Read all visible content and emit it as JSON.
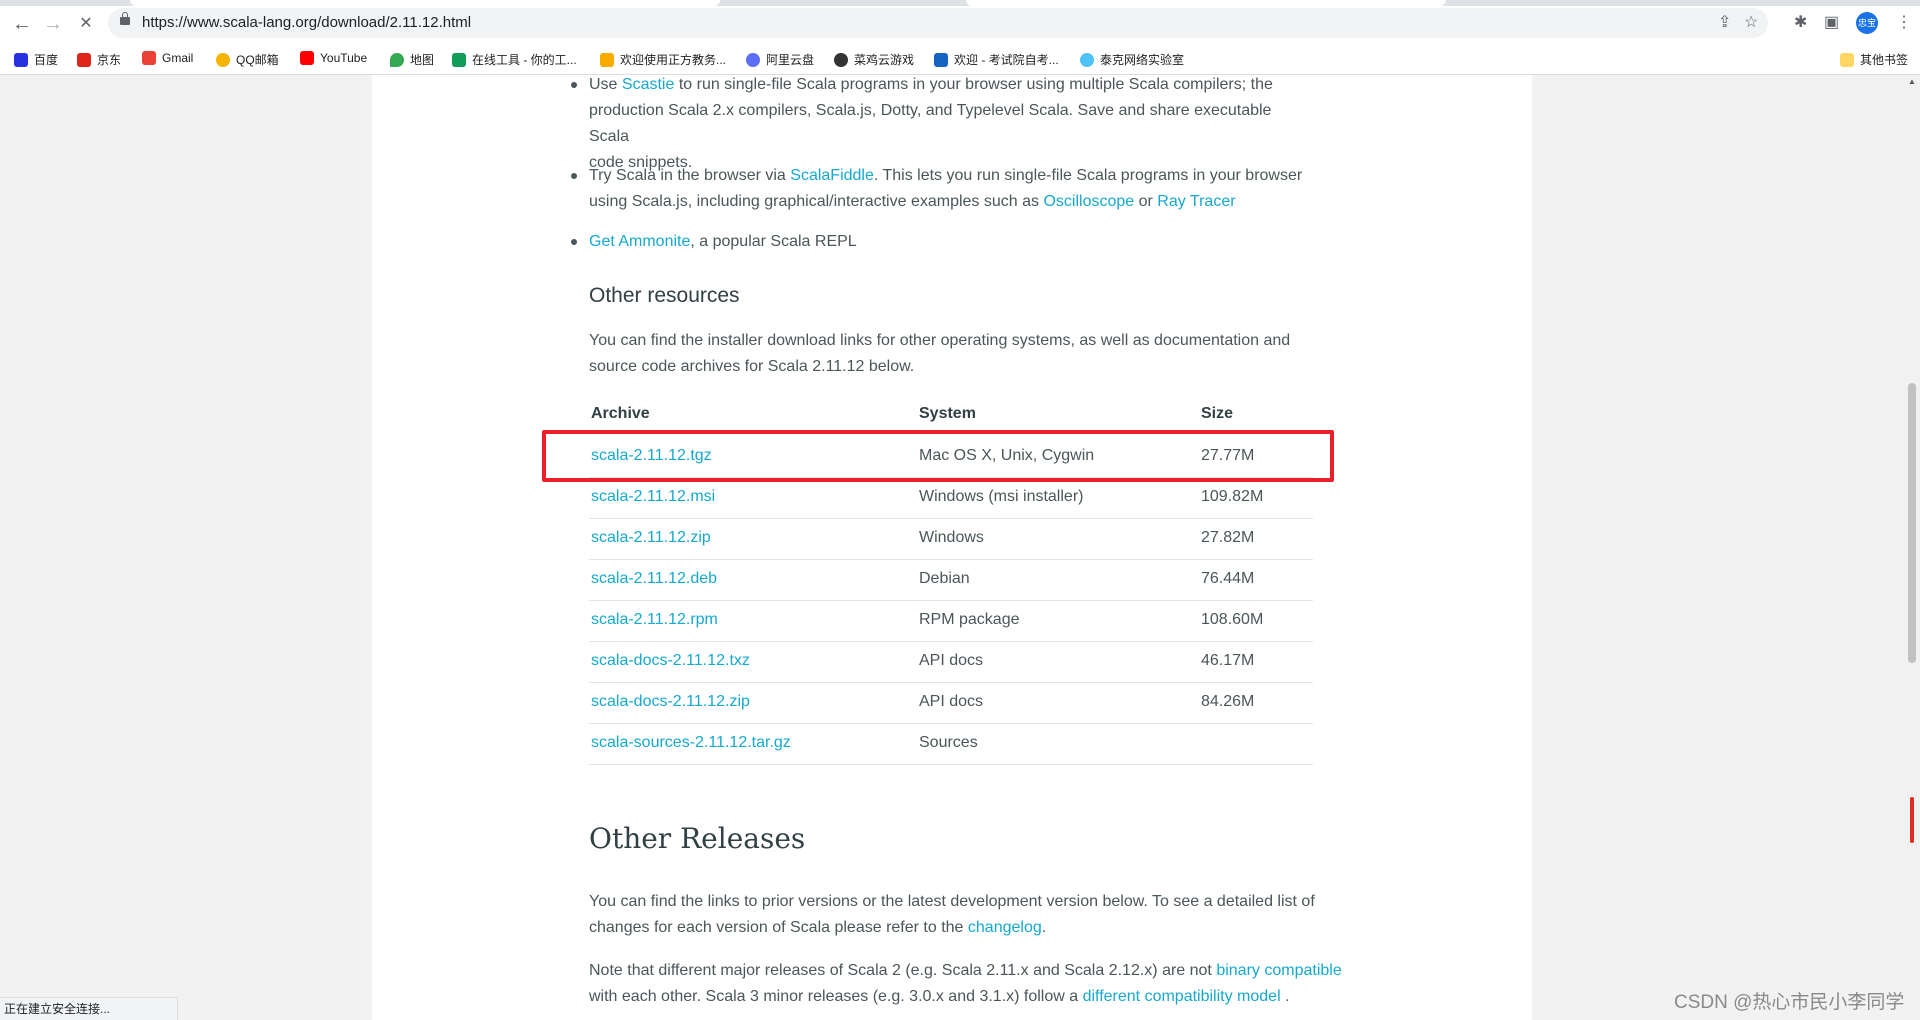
{
  "browser": {
    "url": "https://www.scala-lang.org/download/2.11.12.html",
    "back_label": "←",
    "forward_label": "→",
    "stop_label": "✕",
    "share_icon": "⇪",
    "star_icon": "☆",
    "extensions_icon": "✱",
    "sidepanel_icon": "▣",
    "menu_icon": "⋮",
    "avatar_text": "忠宝",
    "status_text": "正在建立安全连接..."
  },
  "bookmarks": [
    {
      "label": "百度",
      "color": "#2932e1"
    },
    {
      "label": "京东",
      "color": "#e1251b"
    },
    {
      "label": "Gmail",
      "color": "#ea4335"
    },
    {
      "label": "QQ邮箱",
      "color": "#f4b400"
    },
    {
      "label": "YouTube",
      "color": "#ff0000"
    },
    {
      "label": "地图",
      "color": "#34a853"
    },
    {
      "label": "在线工具 - 你的工...",
      "color": "#0f9d58"
    },
    {
      "label": "欢迎使用正方教务...",
      "color": "#f9ab00"
    },
    {
      "label": "阿里云盘",
      "color": "#5b6ef5"
    },
    {
      "label": "菜鸡云游戏",
      "color": "#333333"
    },
    {
      "label": "欢迎 - 考试院自考...",
      "color": "#1565c0"
    },
    {
      "label": "泰克网络实验室",
      "color": "#4fc3f7"
    }
  ],
  "other_bookmarks": "其他书签",
  "intro": {
    "b1_pre": "Use ",
    "b1_link": "Scastie",
    "b1_line1_post": " to run single-file Scala programs in your browser using multiple Scala compilers; the",
    "b1_line2": "production Scala 2.x compilers, Scala.js, Dotty, and Typelevel Scala. Save and share executable Scala",
    "b1_line3": "code snippets.",
    "b2_pre": "Try Scala in the browser via ",
    "b2_link": "ScalaFiddle",
    "b2_line1_post": ". This lets you run single-file Scala programs in your browser",
    "b2_line2_pre": "using Scala.js, including graphical/interactive examples such as ",
    "b2_link2": "Oscilloscope",
    "b2_or": " or ",
    "b2_link3": "Ray Tracer",
    "b3_link": "Get Ammonite",
    "b3_post": ", a popular Scala REPL"
  },
  "other_resources": {
    "heading": "Other resources",
    "line1": "You can find the installer download links for other operating systems, as well as documentation and",
    "line2": "source code archives for Scala 2.11.12 below."
  },
  "table": {
    "headers": {
      "archive": "Archive",
      "system": "System",
      "size": "Size"
    },
    "rows": [
      {
        "archive": "scala-2.11.12.tgz",
        "system": "Mac OS X, Unix, Cygwin",
        "size": "27.77M"
      },
      {
        "archive": "scala-2.11.12.msi",
        "system": "Windows (msi installer)",
        "size": "109.82M"
      },
      {
        "archive": "scala-2.11.12.zip",
        "system": "Windows",
        "size": "27.82M"
      },
      {
        "archive": "scala-2.11.12.deb",
        "system": "Debian",
        "size": "76.44M"
      },
      {
        "archive": "scala-2.11.12.rpm",
        "system": "RPM package",
        "size": "108.60M"
      },
      {
        "archive": "scala-docs-2.11.12.txz",
        "system": "API docs",
        "size": "46.17M"
      },
      {
        "archive": "scala-docs-2.11.12.zip",
        "system": "API docs",
        "size": "84.26M"
      },
      {
        "archive": "scala-sources-2.11.12.tar.gz",
        "system": "Sources",
        "size": ""
      }
    ]
  },
  "other_releases": {
    "heading": "Other Releases",
    "p1_line1": "You can find the links to prior versions or the latest development version below. To see a detailed list of",
    "p1_line2_pre": "changes for each version of Scala please refer to the ",
    "p1_link": "changelog",
    "p1_line2_post": ".",
    "p2_line1_pre": "Note that different major releases of Scala 2 (e.g. Scala 2.11.x and Scala 2.12.x) are not ",
    "p2_link1": "binary compatible",
    "p2_line2_pre": "with each other. Scala 3 minor releases (e.g. 3.0.x and 3.1.x) follow a ",
    "p2_link2": "different compatibility model",
    "p2_line2_post": " ."
  },
  "watermark": "CSDN @热心市民小李同学",
  "colors": {
    "link": "#15a9ce",
    "highlight": "#e8212b",
    "text": "#4a5659"
  }
}
